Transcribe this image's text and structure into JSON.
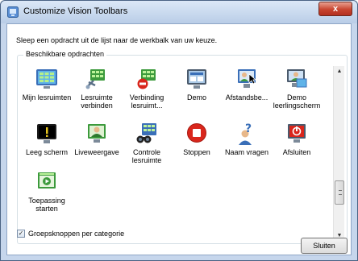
{
  "window": {
    "title": "Customize Vision Toolbars",
    "close_label": "x"
  },
  "instruction": "Sleep een opdracht uit de lijst naar de werkbalk van uw keuze.",
  "group": {
    "title": "Beschikbare opdrachten",
    "items": [
      {
        "label": "Mijn lesruimten",
        "icon": "grid-screen-icon"
      },
      {
        "label": "Lesruimte verbinden",
        "icon": "network-connect-icon"
      },
      {
        "label": "Verbinding lesruimt...",
        "icon": "disconnect-icon"
      },
      {
        "label": "Demo",
        "icon": "demo-icon"
      },
      {
        "label": "Afstandsbe...",
        "icon": "remote-control-icon"
      },
      {
        "label": "Demo leerlingscherm",
        "icon": "demo-student-screen-icon"
      },
      {
        "label": "Leeg scherm",
        "icon": "blank-screen-icon"
      },
      {
        "label": "Liveweergave",
        "icon": "live-view-icon"
      },
      {
        "label": "Controle lesruimte",
        "icon": "monitor-classroom-icon"
      },
      {
        "label": "Stoppen",
        "icon": "stop-icon"
      },
      {
        "label": "Naam vragen",
        "icon": "ask-name-icon"
      },
      {
        "label": "Afsluiten",
        "icon": "shutdown-icon"
      },
      {
        "label": "Toepassing starten",
        "icon": "start-application-icon"
      }
    ]
  },
  "category_checkbox": {
    "label": "Groepsknoppen per categorie",
    "checked": true
  },
  "close_button": {
    "label": "Sluiten"
  },
  "colors": {
    "icon_green": "#3c9a3c",
    "icon_blue": "#3a6fb8",
    "stop_red": "#d9261c"
  }
}
